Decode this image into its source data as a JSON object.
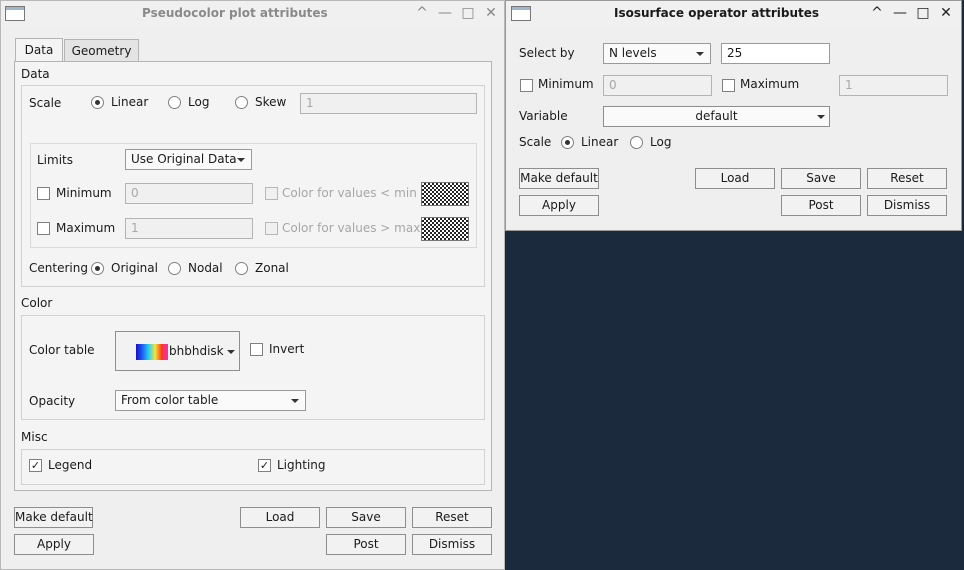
{
  "pseudocolor": {
    "title": "Pseudocolor plot attributes",
    "tabs": [
      "Data",
      "Geometry"
    ],
    "data_group": "Data",
    "scale_label": "Scale",
    "scale_options": [
      "Linear",
      "Log",
      "Skew"
    ],
    "skew_value": "1",
    "limits_label": "Limits",
    "limits_value": "Use Original Data",
    "minimum_label": "Minimum",
    "minimum_value": "0",
    "min_color_label": "Color for values < min",
    "maximum_label": "Maximum",
    "maximum_value": "1",
    "max_color_label": "Color for values > max",
    "centering_label": "Centering",
    "centering_options": [
      "Original",
      "Nodal",
      "Zonal"
    ],
    "color_group": "Color",
    "color_table_label": "Color table",
    "color_table_value": "bhbhdisk",
    "invert_label": "Invert",
    "opacity_label": "Opacity",
    "opacity_value": "From color table",
    "misc_group": "Misc",
    "legend_label": "Legend",
    "lighting_label": "Lighting",
    "buttons": {
      "make_default": "Make default",
      "load": "Load",
      "save": "Save",
      "reset": "Reset",
      "apply": "Apply",
      "post": "Post",
      "dismiss": "Dismiss"
    }
  },
  "isosurface": {
    "title": "Isosurface operator attributes",
    "select_by_label": "Select by",
    "select_by_value": "N levels",
    "levels_value": "25",
    "minimum_label": "Minimum",
    "minimum_value": "0",
    "maximum_label": "Maximum",
    "maximum_value": "1",
    "variable_label": "Variable",
    "variable_value": "default",
    "scale_label": "Scale",
    "scale_options": [
      "Linear",
      "Log"
    ],
    "buttons": {
      "make_default": "Make default",
      "load": "Load",
      "save": "Save",
      "reset": "Reset",
      "apply": "Apply",
      "post": "Post",
      "dismiss": "Dismiss"
    }
  },
  "title_buttons": {
    "up": "^",
    "minimize": "—",
    "maximize": "□",
    "close": "✕"
  },
  "colors": {
    "desktop": "#1c2a3e",
    "window": "#efefef"
  }
}
